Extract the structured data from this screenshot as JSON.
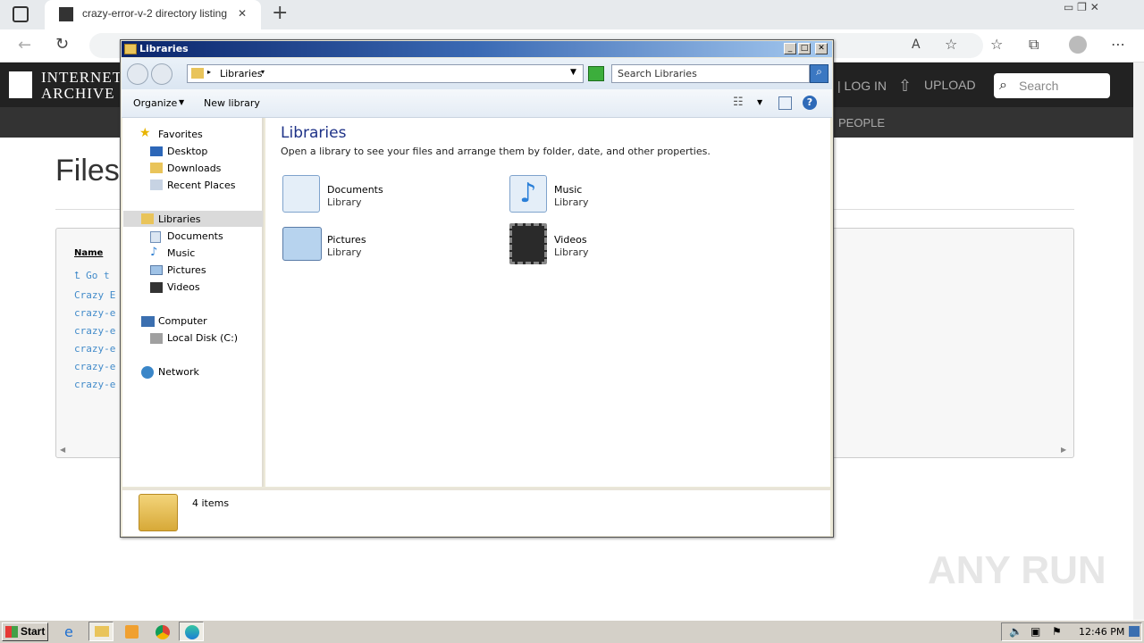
{
  "browser": {
    "tab_title": "crazy-error-v-2 directory listing",
    "new_tab": "+",
    "close_tab": "✕"
  },
  "ia": {
    "logo_line1": "INTERNET",
    "logo_line2": "ARCHIVE",
    "login": "| LOG IN",
    "upload": "UPLOAD",
    "search_placeholder": "Search",
    "nav_people": "PEOPLE",
    "files_heading": "Files",
    "name_header": "Name",
    "go_up": "Go t",
    "rows": [
      "Crazy E",
      "crazy-e",
      "crazy-e",
      "crazy-e",
      "crazy-e",
      "crazy-e"
    ]
  },
  "explorer": {
    "title": "Libraries",
    "breadcrumb": "Libraries",
    "search_placeholder": "Search Libraries",
    "organize": "Organize",
    "new_library": "New library",
    "heading": "Libraries",
    "description": "Open a library to see your files and arrange them by folder, date, and other properties.",
    "nav": {
      "favorites": "Favorites",
      "desktop": "Desktop",
      "downloads": "Downloads",
      "recent": "Recent Places",
      "libraries": "Libraries",
      "documents": "Documents",
      "music": "Music",
      "pictures": "Pictures",
      "videos": "Videos",
      "computer": "Computer",
      "local_disk": "Local Disk (C:)",
      "network": "Network"
    },
    "items": [
      {
        "name": "Documents",
        "sub": "Library"
      },
      {
        "name": "Music",
        "sub": "Library"
      },
      {
        "name": "Pictures",
        "sub": "Library"
      },
      {
        "name": "Videos",
        "sub": "Library"
      }
    ],
    "status": "4 items"
  },
  "taskbar": {
    "start": "Start",
    "time": "12:46 PM"
  },
  "watermark": "ANY RUN"
}
